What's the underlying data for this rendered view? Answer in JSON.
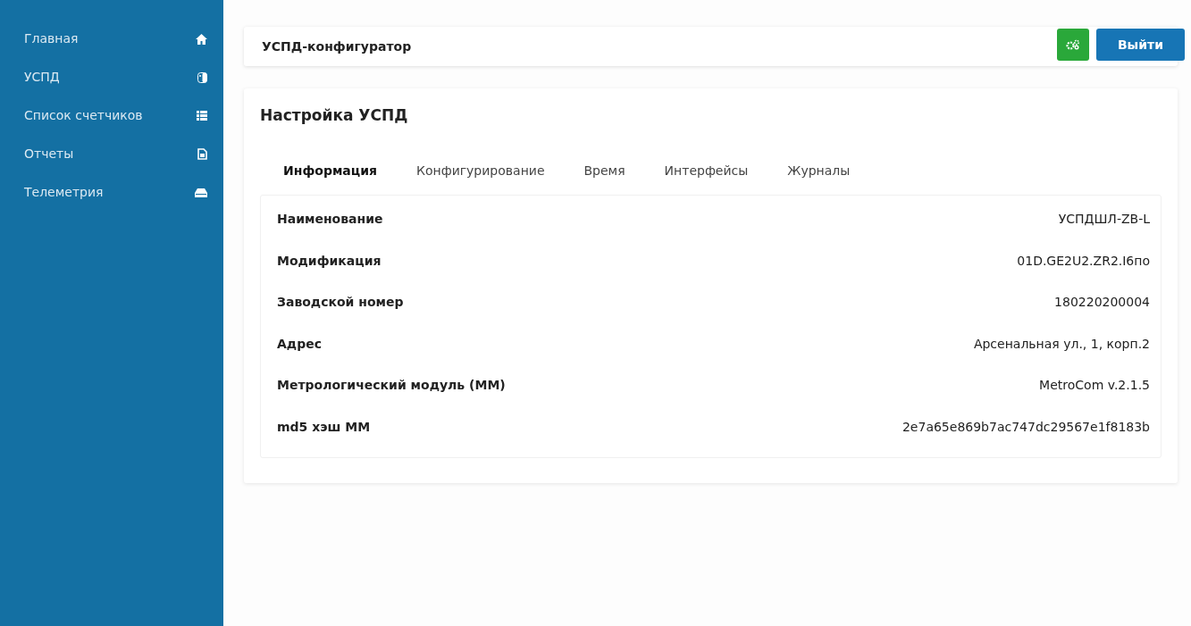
{
  "sidebar": {
    "items": [
      {
        "label": "Главная"
      },
      {
        "label": "УСПД"
      },
      {
        "label": "Список счетчиков"
      },
      {
        "label": "Отчеты"
      },
      {
        "label": "Телеметрия"
      }
    ]
  },
  "header": {
    "title": "УСПД-конфигуратор",
    "logout_button": "Выйти"
  },
  "panel": {
    "title": "Настройка УСПД",
    "tabs": [
      {
        "label": "Информация",
        "selected": true
      },
      {
        "label": "Конфигурирование",
        "selected": false
      },
      {
        "label": "Время",
        "selected": false
      },
      {
        "label": "Интерфейсы",
        "selected": false
      },
      {
        "label": "Журналы",
        "selected": false
      }
    ],
    "rows": [
      {
        "label": "Наименование",
        "value": "УСПДШЛ-ZB-L"
      },
      {
        "label": "Модификация",
        "value": "01D.GE2U2.ZR2.I6по"
      },
      {
        "label": "Заводской номер",
        "value": "180220200004"
      },
      {
        "label": "Адрес",
        "value": "Арсенальная ул., 1, корп.2"
      },
      {
        "label": "Метрологический модуль (ММ)",
        "value": "MetroCom v.2.1.5"
      },
      {
        "label": "md5 хэш ММ",
        "value": "2e7a65e869b7ac747dc29567e1f8183b"
      }
    ]
  }
}
